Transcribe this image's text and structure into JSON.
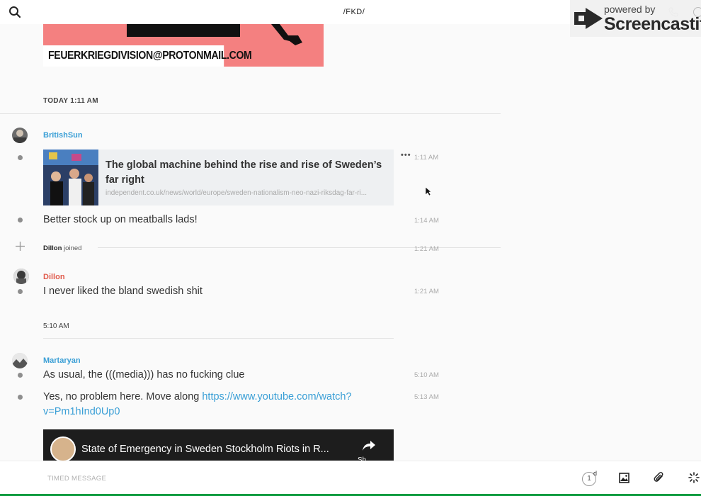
{
  "header": {
    "title": "/FKD/"
  },
  "watermark": {
    "line1": "powered by",
    "line2": "Screencastify"
  },
  "poster": {
    "email": "FEUERKRIEGDIVISION@PROTONMAIL.COM"
  },
  "day_separator": "TODAY 1:11 AM",
  "messages": {
    "m1": {
      "author": "BritishSun",
      "author_color": "#3a9fd6"
    },
    "link": {
      "title": "The global machine behind the rise and rise of Sweden’s far right",
      "url": "independent.co.uk/news/world/europe/sweden-nationalism-neo-nazi-riksdag-far-ri...",
      "time": "1:11 AM",
      "more": "•••"
    },
    "m2": {
      "text": "Better stock up on meatballs lads!",
      "time": "1:14 AM"
    },
    "join": {
      "name": "Dillon",
      "action": "joined",
      "time": "1:21 AM"
    },
    "m3": {
      "author": "Dillon",
      "author_color": "#e05a4b",
      "text": "I never liked the bland swedish shit",
      "time": "1:21 AM"
    },
    "time_separator": "5:10 AM",
    "m4": {
      "author": "Martaryan",
      "author_color": "#3a9fd6",
      "text": "As usual, the (((media))) has no fucking clue",
      "time": "5:10 AM"
    },
    "m5": {
      "text": "Yes, no problem here. Move along ",
      "link": "https://www.youtube.com/watch?v=Pm1hInd0Up0",
      "time": "5:13 AM"
    },
    "video": {
      "title": "State of Emergency in Sweden Stockholm Riots in R...",
      "share_label": "Sh"
    }
  },
  "composer": {
    "placeholder": "TIMED MESSAGE",
    "timer_value": "1",
    "timer_unit": "d"
  }
}
